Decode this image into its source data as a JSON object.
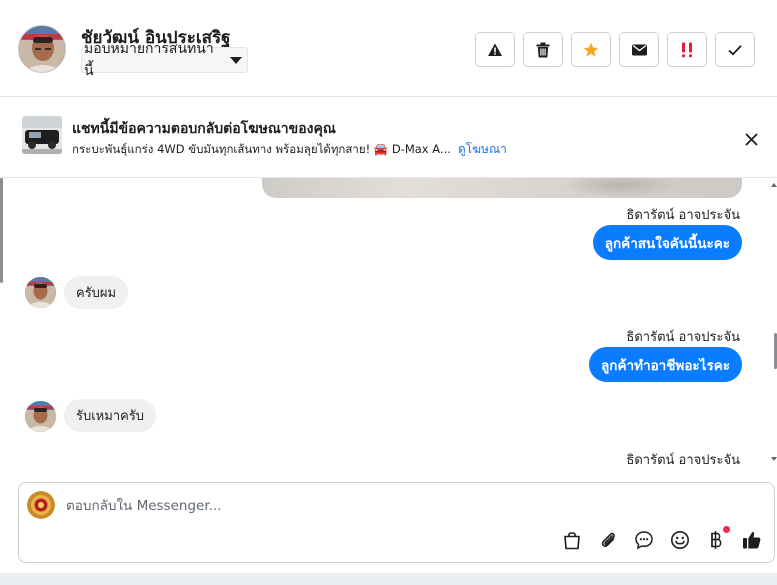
{
  "header": {
    "contact_name": "ชัยวัฒน์ อินประเสริฐ",
    "assign_label": "มอบหมายการสนทนานี้",
    "actions": [
      {
        "name": "report-spam-button",
        "icon": "warning-icon"
      },
      {
        "name": "delete-button",
        "icon": "trash-icon"
      },
      {
        "name": "star-button",
        "icon": "star-icon"
      },
      {
        "name": "mark-unread-button",
        "icon": "envelope-icon"
      },
      {
        "name": "follow-up-button",
        "icon": "double-exclamation-icon"
      },
      {
        "name": "mark-done-button",
        "icon": "checkmark-icon"
      }
    ]
  },
  "ad_banner": {
    "title": "แชทนี้มีข้อความตอบกลับต่อโฆษณาของคุณ",
    "subtitle": "กระบะพันธุ์แกร่ง 4WD ขับมันทุกเส้นทาง พร้อมลุยได้ทุกสาย! 🚘 D-Max A...",
    "link_label": "ดูโฆษณา"
  },
  "messages": [
    {
      "type": "sender",
      "text": "ธิดารัตน์ อาจประจัน"
    },
    {
      "type": "outgoing",
      "text": "ลูกค้าสนใจคันนี้นะคะ"
    },
    {
      "type": "incoming",
      "text": "ครับผม"
    },
    {
      "type": "sender",
      "text": "ธิดารัตน์ อาจประจัน"
    },
    {
      "type": "outgoing",
      "text": "ลูกค้าทำอาชีพอะไรคะ"
    },
    {
      "type": "incoming",
      "text": "รับเหมาครับ"
    },
    {
      "type": "sender",
      "text": "ธิดารัตน์ อาจประจัน"
    }
  ],
  "composer": {
    "placeholder": "ตอบกลับใน Messenger...",
    "tools": [
      "shopping-bag-icon",
      "paperclip-icon",
      "saved-reply-icon",
      "emoji-icon",
      "baht-payment-icon",
      "thumbs-up-icon"
    ]
  },
  "colors": {
    "accent": "#0a7cff",
    "link": "#1b74e4",
    "star": "#f5a623",
    "alert": "#e41e3f",
    "incoming_bubble": "#f0f0f0"
  }
}
